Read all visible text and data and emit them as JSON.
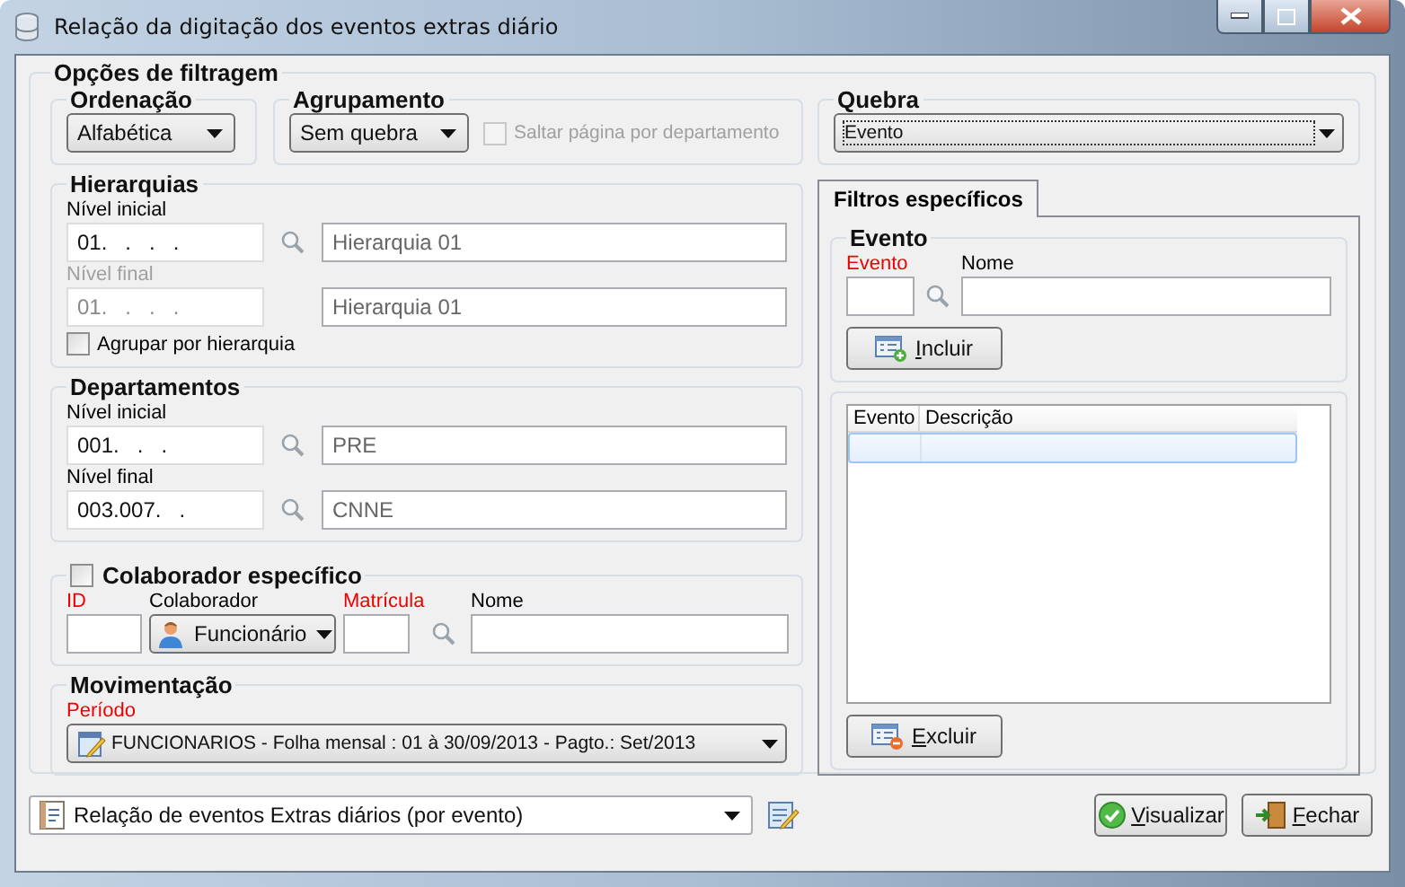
{
  "window": {
    "title": "Relação da digitação dos eventos extras diário"
  },
  "filter_group": {
    "title": "Opções de filtragem"
  },
  "ordenacao": {
    "title": "Ordenação",
    "value": "Alfabética"
  },
  "agrupamento": {
    "title": "Agrupamento",
    "value": "Sem quebra",
    "skip_page": {
      "label": "Saltar página por departamento",
      "checked": false,
      "disabled": true
    }
  },
  "hierarquias": {
    "title": "Hierarquias",
    "levels": [
      {
        "label": "Nível inicial",
        "code": "01.   .   .   .",
        "name": "Hierarquia 01",
        "disabled": false
      },
      {
        "label": "Nível final",
        "code": "01.   .   .   .",
        "name": "Hierarquia 01",
        "disabled": true
      }
    ],
    "group_checkbox": {
      "label": "Agrupar por hierarquia",
      "checked": false
    }
  },
  "departamentos": {
    "title": "Departamentos",
    "levels": [
      {
        "label": "Nível inicial",
        "code": "001.   .   .",
        "name": "PRE",
        "disabled": false
      },
      {
        "label": "Nível final",
        "code": "003.007.   .",
        "name": "CNNE",
        "disabled": false
      }
    ]
  },
  "colaborador": {
    "title": "Colaborador específico",
    "checked": false,
    "labels": [
      {
        "text": "ID",
        "required": true
      },
      {
        "text": "Colaborador",
        "required": false
      },
      {
        "text": "Matrícula",
        "required": true
      },
      {
        "text": "Nome",
        "required": false
      }
    ],
    "type_value": "Funcionário"
  },
  "movimentacao": {
    "title": "Movimentação",
    "period_label": {
      "text": "Período",
      "required": true
    },
    "value": "FUNCIONARIOS - Folha mensal : 01 à 30/09/2013 - Pagto.: Set/2013"
  },
  "quebra": {
    "title": "Quebra",
    "value": "Evento"
  },
  "tabs": [
    {
      "label": "Filtros específicos",
      "selected": true
    }
  ],
  "evento": {
    "title": "Evento",
    "labels": [
      {
        "text": "Evento",
        "required": true
      },
      {
        "text": "Nome",
        "required": false
      }
    ],
    "include_button": "Incluir"
  },
  "table": {
    "columns": [
      "Evento",
      "Descrição"
    ]
  },
  "exclude_button": "Excluir",
  "footer": {
    "report": "Relação de eventos Extras diários (por evento)",
    "view_button": "Visualizar",
    "close_button": "Fechar"
  }
}
